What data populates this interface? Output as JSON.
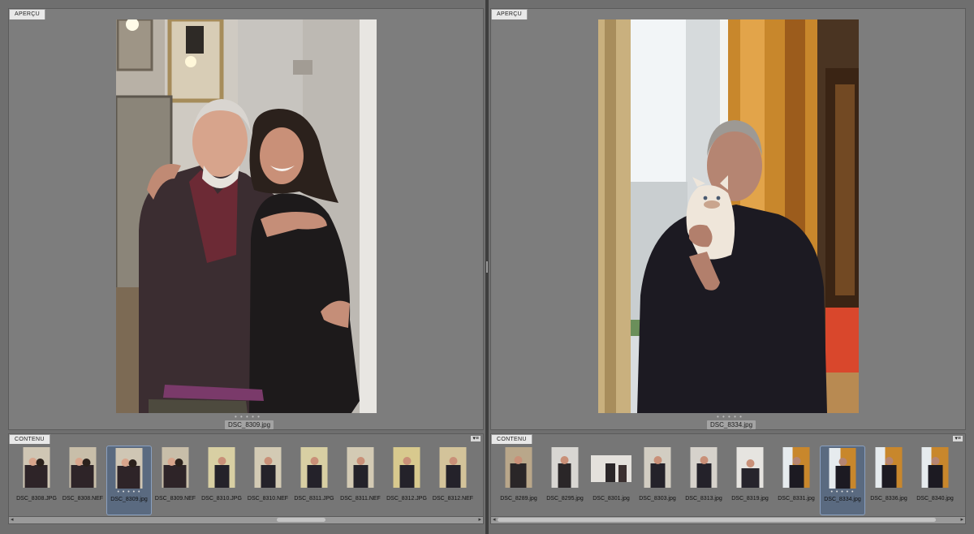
{
  "colors": {
    "panel": "#6f6f6f",
    "preview_bg": "#7d7d7d",
    "selected_thumb": "#5a6a80",
    "tab_bg": "#e8e8e8"
  },
  "left": {
    "preview_tab": "APERÇU",
    "caption": "DSC_8309.jpg",
    "content_tab": "CONTENU",
    "thumbs": [
      {
        "label": "DSC_8308.JPG",
        "selected": false
      },
      {
        "label": "DSC_8308.NEF",
        "selected": false
      },
      {
        "label": "DSC_8309.jpg",
        "selected": true
      },
      {
        "label": "DSC_8309.NEF",
        "selected": false
      },
      {
        "label": "DSC_8310.JPG",
        "selected": false
      },
      {
        "label": "DSC_8310.NEF",
        "selected": false
      },
      {
        "label": "DSC_8311.JPG",
        "selected": false
      },
      {
        "label": "DSC_8311.NEF",
        "selected": false
      },
      {
        "label": "DSC_8312.JPG",
        "selected": false
      },
      {
        "label": "DSC_8312.NEF",
        "selected": false
      }
    ]
  },
  "right": {
    "preview_tab": "APERÇU",
    "caption": "DSC_8334.jpg",
    "content_tab": "CONTENU",
    "thumbs": [
      {
        "label": "DSC_8289.jpg",
        "selected": false
      },
      {
        "label": "DSC_8295.jpg",
        "selected": false
      },
      {
        "label": "DSC_8301.jpg",
        "selected": false
      },
      {
        "label": "DSC_8303.jpg",
        "selected": false
      },
      {
        "label": "DSC_8313.jpg",
        "selected": false
      },
      {
        "label": "DSC_8319.jpg",
        "selected": false
      },
      {
        "label": "DSC_8331.jpg",
        "selected": false
      },
      {
        "label": "DSC_8334.jpg",
        "selected": true
      },
      {
        "label": "DSC_8336.jpg",
        "selected": false
      },
      {
        "label": "DSC_8340.jpg",
        "selected": false
      }
    ]
  }
}
